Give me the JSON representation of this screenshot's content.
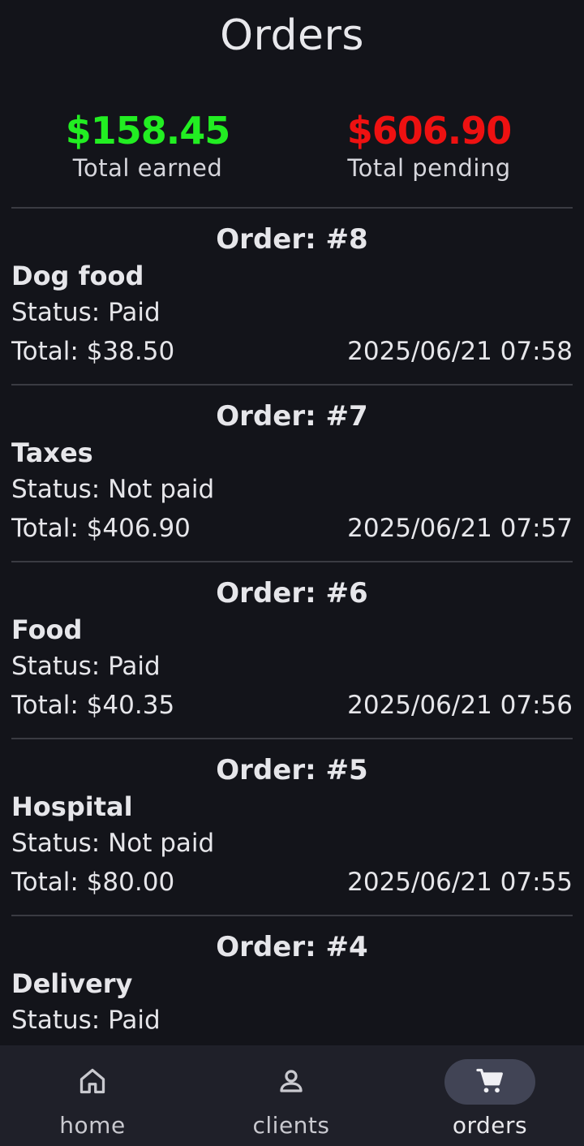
{
  "header": {
    "title": "Orders"
  },
  "summary": {
    "earned": {
      "amount": "$158.45",
      "label": "Total earned",
      "color": "#22ee22"
    },
    "pending": {
      "amount": "$606.90",
      "label": "Total pending",
      "color": "#ee1111"
    }
  },
  "orders": [
    {
      "number": "Order: #8",
      "name": "Dog food",
      "status": "Status: Paid",
      "total": "Total: $38.50",
      "date": "2025/06/21 07:58"
    },
    {
      "number": "Order: #7",
      "name": "Taxes",
      "status": "Status: Not paid",
      "total": "Total: $406.90",
      "date": "2025/06/21 07:57"
    },
    {
      "number": "Order: #6",
      "name": "Food",
      "status": "Status: Paid",
      "total": "Total: $40.35",
      "date": "2025/06/21 07:56"
    },
    {
      "number": "Order: #5",
      "name": "Hospital",
      "status": "Status: Not paid",
      "total": "Total: $80.00",
      "date": "2025/06/21 07:55"
    },
    {
      "number": "Order: #4",
      "name": "Delivery",
      "status": "Status: Paid",
      "total": "",
      "date": ""
    }
  ],
  "nav": {
    "items": [
      {
        "label": "home",
        "icon": "home-icon"
      },
      {
        "label": "clients",
        "icon": "person-icon"
      },
      {
        "label": "orders",
        "icon": "cart-icon",
        "active": true
      }
    ]
  }
}
